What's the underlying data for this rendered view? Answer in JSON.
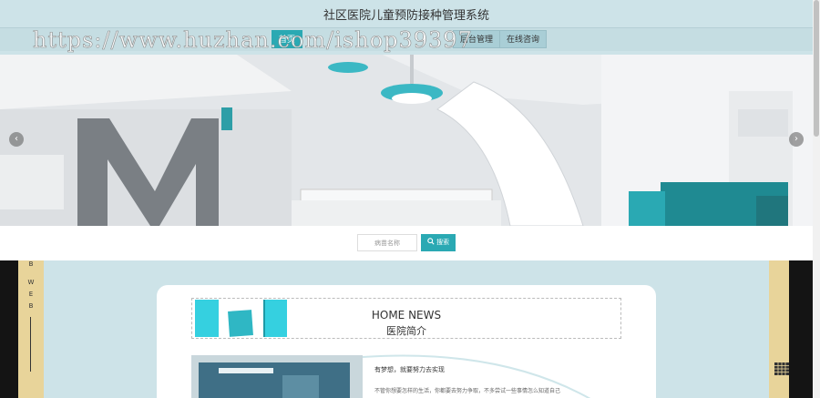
{
  "header": {
    "title": "社区医院儿童预防接种管理系统",
    "watermark": "https://www.huzhan.com/ishop39397"
  },
  "nav": {
    "items": [
      {
        "label": "首页",
        "active": true
      },
      {
        "label": "后台管理",
        "active": false
      },
      {
        "label": "在线咨询",
        "active": false
      }
    ]
  },
  "banner": {
    "prev_icon": "chevron-left-icon",
    "next_icon": "chevron-right-icon",
    "prev_glyph": "‹",
    "next_glyph": "›"
  },
  "search": {
    "placeholder": "病苗名称",
    "button_label": "搜索",
    "button_icon": "search-icon"
  },
  "side": {
    "left_text": [
      "B",
      "W",
      "E",
      "B"
    ]
  },
  "news": {
    "title": "HOME NEWS",
    "subtitle": "医院简介"
  },
  "intro": {
    "heading": "有梦想，就要努力去实现",
    "text": "不管你想要怎样的生活，你都要去努力争取，不多尝试一些事情怎么知道自己"
  },
  "colors": {
    "accent": "#2aa9b3",
    "header_bg": "#cde3e8",
    "side_band": "#e8d49a"
  }
}
